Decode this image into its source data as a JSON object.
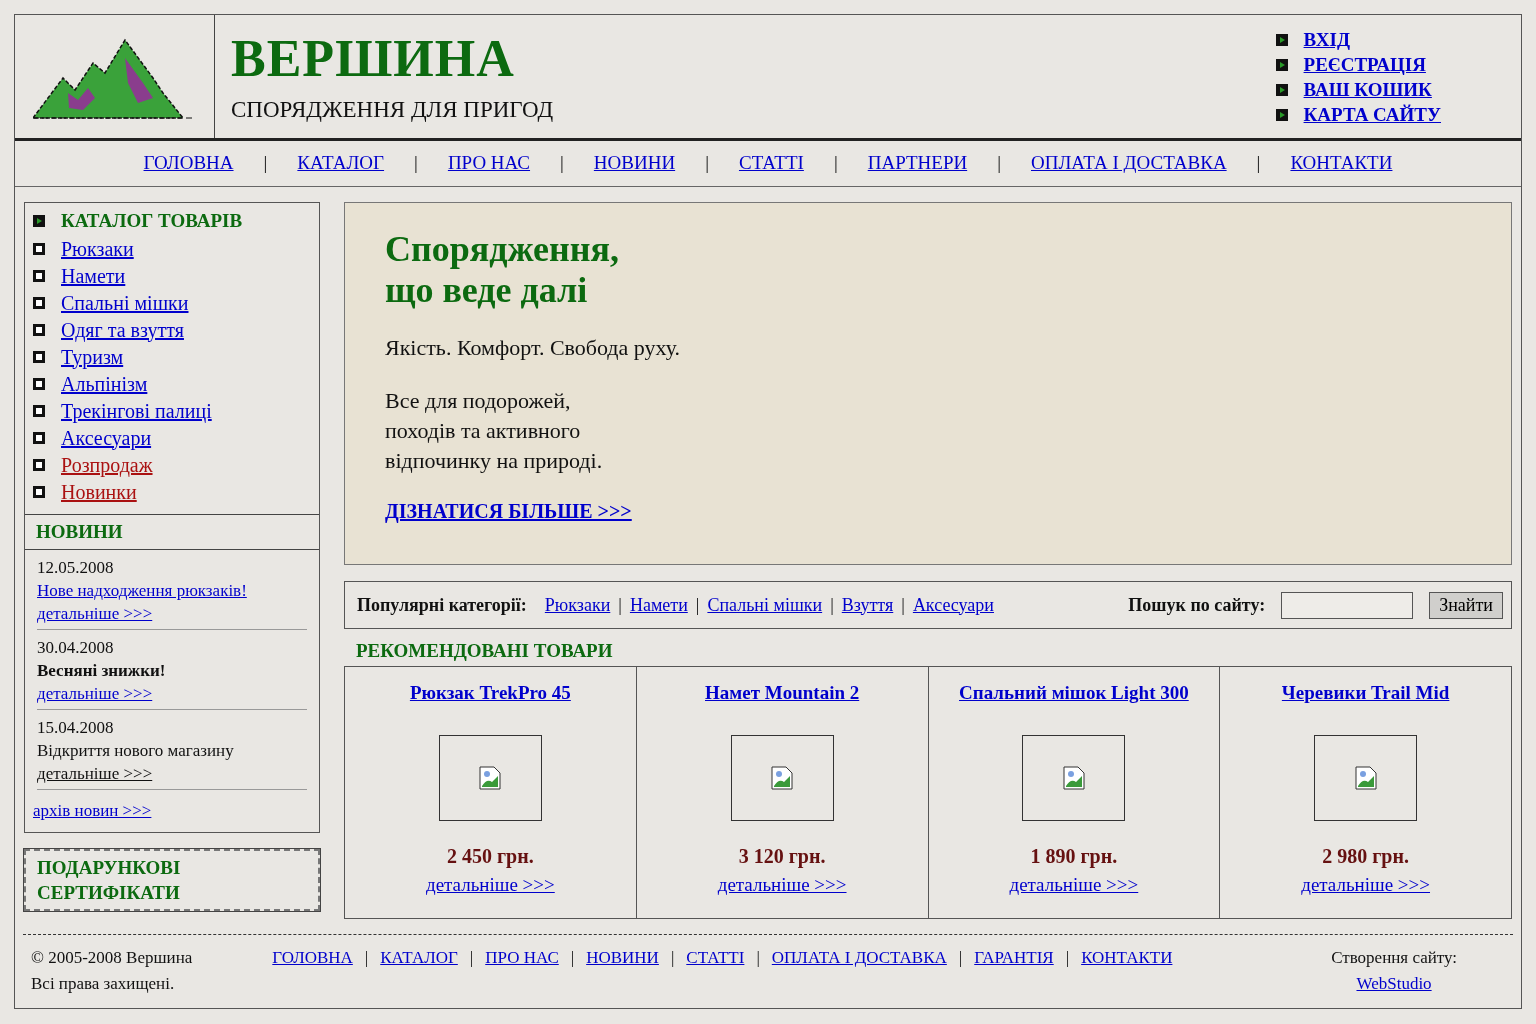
{
  "header": {
    "title": "ВЕРШИНА",
    "subtitle": "СПОРЯДЖЕННЯ ДЛЯ ПРИГОД",
    "user_links": [
      "ВХІД",
      "РЕЄСТРАЦІЯ",
      "ВАШ КОШИК",
      "КАРТА САЙТУ"
    ]
  },
  "nav": {
    "separator": "|",
    "items": [
      "ГОЛОВНА",
      "КАТАЛОГ",
      "ПРО НАС",
      "НОВИНИ",
      "СТАТТІ",
      "ПАРТНЕРИ",
      "ОПЛАТА І ДОСТАВКА",
      "КОНТАКТИ"
    ]
  },
  "sidebar": {
    "catalog_title": "КАТАЛОГ ТОВАРІВ",
    "catalog": [
      {
        "label": "Рюкзаки",
        "kind": "normal"
      },
      {
        "label": "Намети",
        "kind": "normal"
      },
      {
        "label": "Спальні мішки",
        "kind": "normal"
      },
      {
        "label": "Одяг та взуття",
        "kind": "normal"
      },
      {
        "label": "Туризм",
        "kind": "normal"
      },
      {
        "label": "Альпінізм",
        "kind": "normal"
      },
      {
        "label": "Трекінгові палиці",
        "kind": "normal"
      },
      {
        "label": "Аксесуари",
        "kind": "normal"
      },
      {
        "label": "Розпродаж",
        "kind": "highlight"
      },
      {
        "label": "Новинки",
        "kind": "highlight"
      }
    ],
    "news_title": "НОВИНИ",
    "news": [
      {
        "date": "12.05.2008",
        "title": "Нове надходження рюкзаків!",
        "more": "детальніше >>>",
        "kind": "link"
      },
      {
        "date": "30.04.2008",
        "title": "Весняні знижки!",
        "more": "детальніше >>>",
        "kind": "bold"
      },
      {
        "date": "15.04.2008",
        "title": "Відкриття нового магазину",
        "more": "детальніше >>>",
        "kind": "plain"
      }
    ],
    "archive": "архів новин >>>",
    "gift": "ПОДАРУНКОВІ СЕРТИФІКАТИ"
  },
  "hero": {
    "heading": "Спорядження,\nщо веде далі",
    "tagline": "Якість. Комфорт. Свобода руху.",
    "text": "Все для подорожей,\nпоходів та активного\nвідпочинку на природі.",
    "link": "ДІЗНАТИСЯ БІЛЬШЕ >>>"
  },
  "popular": {
    "label": "Популярні категорії:",
    "links": [
      "Рюкзаки",
      "Намети",
      "Спальні мішки",
      "Взуття",
      "Аксесуари"
    ],
    "separator": "|",
    "search_label": "Пошук по сайту:",
    "search_button": "Знайти"
  },
  "featured": {
    "title": "РЕКОМЕНДОВАНІ ТОВАРИ",
    "products": [
      {
        "name": "Рюкзак TrekPro 45",
        "price": "2 450 грн.",
        "more": "детальніше >>>"
      },
      {
        "name": "Намет Mountain 2",
        "price": "3 120 грн.",
        "more": "детальніше >>>"
      },
      {
        "name": "Спальний мішок Light 300",
        "price": "1 890 грн.",
        "more": "детальніше >>>"
      },
      {
        "name": "Черевики Trail Mid",
        "price": "2 980 грн.",
        "more": "детальніше >>>"
      }
    ]
  },
  "footer": {
    "copyright": "© 2005-2008 Вершина",
    "rights": "Всі права захищені.",
    "links": [
      "ГОЛОВНА",
      "КАТАЛОГ",
      "ПРО НАС",
      "НОВИНИ",
      "СТАТТІ",
      "ОПЛАТА І ДОСТАВКА",
      "ГАРАНТІЯ",
      "КОНТАКТИ"
    ],
    "separator": "|",
    "credit_label": "Створення сайту:",
    "credit_link": "WebStudio"
  }
}
